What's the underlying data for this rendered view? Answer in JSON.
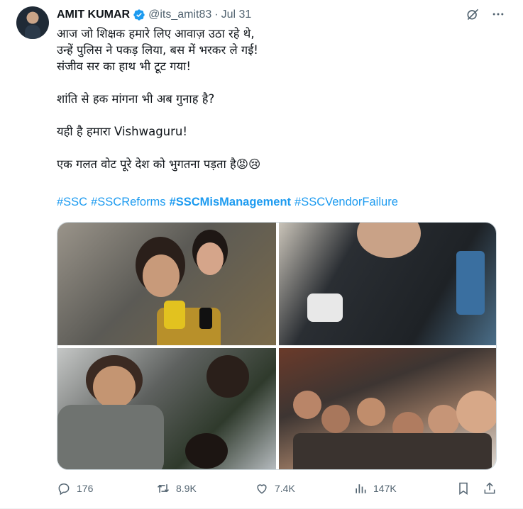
{
  "author": {
    "name": "AMIT KUMAR",
    "handle": "@its_amit83",
    "separator": "·",
    "date": "Jul 31"
  },
  "tweet_text": {
    "line1": "आज जो शिक्षक हमारे लिए आवाज़ उठा रहे थे,",
    "line2": "उन्हें पुलिस ने पकड़ लिया, बस में भरकर ले गई!",
    "line3": "संजीव सर का हाथ भी टूट गया!",
    "line4": "शांति से हक मांगना भी अब गुनाह है?",
    "line5": "यही है हमारा Vishwaguru!",
    "line6": "एक गलत वोट पूरे देश को भुगतना पड़ता है😡😢"
  },
  "hashtags": [
    "#SSC",
    "#SSCReforms",
    "#SSCMisManagement",
    "#SSCVendorFailure"
  ],
  "stats": {
    "replies": "176",
    "reposts": "8.9K",
    "likes": "7.4K",
    "views": "147K"
  },
  "colors": {
    "accent": "#1d9bf0",
    "muted": "#536471",
    "text": "#0f1419"
  },
  "icons": [
    "verified-badge-icon",
    "grok-icon",
    "more-icon",
    "reply-icon",
    "retweet-icon",
    "like-icon",
    "views-icon",
    "bookmark-icon",
    "share-icon"
  ]
}
